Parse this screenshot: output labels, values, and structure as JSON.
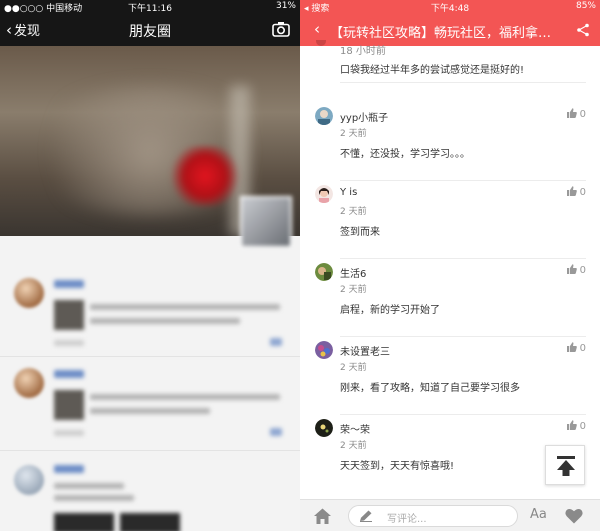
{
  "left": {
    "status": {
      "carrier": "●●○○○ 中国移动",
      "time": "下午11:16",
      "battery": "31%"
    },
    "nav": {
      "back_label": "发现",
      "title": "朋友圈"
    }
  },
  "right": {
    "status": {
      "back_app": "搜索",
      "time": "下午4:48",
      "battery": "85%"
    },
    "nav": {
      "title": "【玩转社区攻略】畅玩社区，福利拿不..."
    },
    "partial_comment": {
      "time": "18 小时前",
      "body": "口袋我经过半年多的尝试感觉还是挺好的!"
    },
    "comments": [
      {
        "name": "yyp小瓶子",
        "time": "2 天前",
        "body": "不懂，还没投，学习学习。。。",
        "likes": "0"
      },
      {
        "name": "Y is",
        "time": "2 天前",
        "body": "签到而来",
        "likes": "0"
      },
      {
        "name": "生活6",
        "time": "2 天前",
        "body": "启程，新的学习开始了",
        "likes": "0"
      },
      {
        "name": "未设置老三",
        "time": "2 天前",
        "body": "刚来，看了攻略，知道了自己要学习很多",
        "likes": "0"
      },
      {
        "name": "荣～荣",
        "time": "2 天前",
        "body": "天天签到，天天有惊喜哦!",
        "likes": "0"
      }
    ],
    "bottom": {
      "placeholder": "写评论...",
      "font_label": "Aa"
    }
  }
}
